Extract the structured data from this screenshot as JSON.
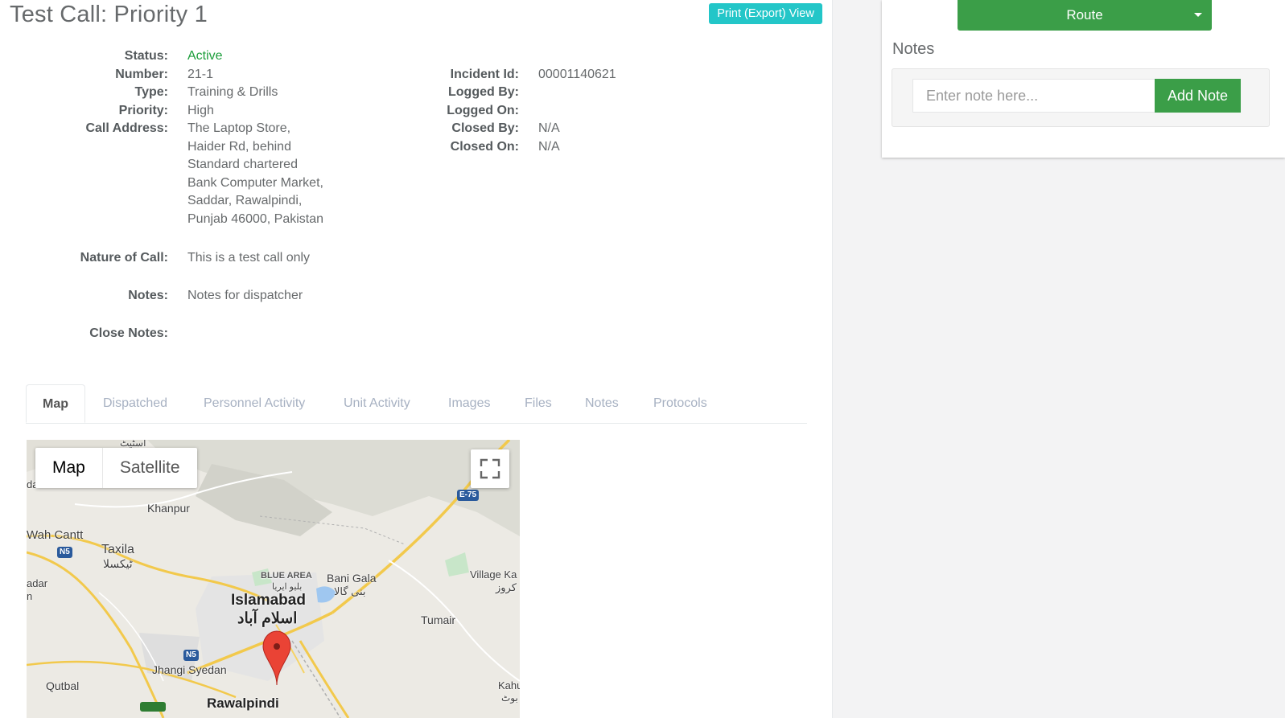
{
  "header": {
    "title": "Test Call: Priority 1",
    "print_label": "Print (Export) View"
  },
  "details_left": [
    {
      "label": "Status:",
      "value": "Active"
    },
    {
      "label": "Number:",
      "value": "21-1"
    },
    {
      "label": "Type:",
      "value": "Training & Drills"
    },
    {
      "label": "Priority:",
      "value": "High"
    },
    {
      "label": "Call Address:",
      "value_lines": [
        "The Laptop Store,",
        "Haider Rd, behind",
        "Standard chartered",
        "Bank Computer Market,",
        "Saddar, Rawalpindi,",
        "Punjab 46000, Pakistan"
      ]
    },
    {
      "label": "Nature of Call:",
      "value": "This is a test call only"
    },
    {
      "label": "Notes:",
      "value": "Notes for dispatcher"
    },
    {
      "label": "Close Notes:",
      "value": ""
    }
  ],
  "details_right": [
    {
      "label": "Incident Id:",
      "value": "00001140621"
    },
    {
      "label": "Logged By:",
      "value": ""
    },
    {
      "label": "Logged On:",
      "value": ""
    },
    {
      "label": "Closed By:",
      "value": "N/A"
    },
    {
      "label": "Closed On:",
      "value": "N/A"
    }
  ],
  "tabs": [
    "Map",
    "Dispatched",
    "Personnel Activity",
    "Unit Activity",
    "Images",
    "Files",
    "Notes",
    "Protocols"
  ],
  "map": {
    "type_map": "Map",
    "type_satellite": "Satellite",
    "places": {
      "khanpur": "Khanpur",
      "wah": "Wah Cantt",
      "taxila": "Taxila",
      "taxila_ur": "ٹیکسلا",
      "blue_area": "BLUE AREA",
      "blue_area_ur": "بلیو ایریا",
      "islamabad": "Islamabad",
      "islamabad_ur": "اسلام آباد",
      "bani_gala": "Bani Gala",
      "bani_gala_ur": "بنی گالا",
      "village": "Village Ka",
      "village_ur": "کروز",
      "tumair": "Tumair",
      "jhangi": "Jhangi Syedan",
      "qutbal": "Qutbal",
      "rawalpindi": "Rawalpindi",
      "kahu": "Kahu",
      "kahu_ur": "بوٹ",
      "top_ur": "اسٹیٹ",
      "left_partial": "da",
      "adar": "adar",
      "n": "n"
    },
    "shields": {
      "n5a": "N5",
      "n5b": "N5",
      "e75": "E-75"
    }
  },
  "sidebar": {
    "route_label": "Route",
    "notes_heading": "Notes",
    "note_placeholder": "Enter note here...",
    "add_note_label": "Add Note"
  },
  "colors": {
    "status_active": "#1c9e3b",
    "print_button": "#23c6c8",
    "primary_green": "#3b9e48",
    "map_pin": "#e53935"
  }
}
